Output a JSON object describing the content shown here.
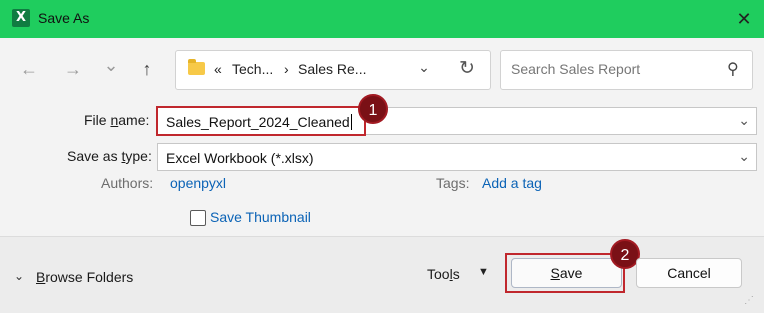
{
  "window": {
    "title": "Save As",
    "app_icon_letter": "X",
    "close_glyph": "✕"
  },
  "nav": {
    "back_glyph": "←",
    "forward_glyph": "→",
    "recent_glyph": "⌄",
    "up_glyph": "↑",
    "breadcrumb_overflow": "«",
    "crumb_1": "Tech...",
    "crumb_sep": "›",
    "crumb_2": "Sales Re...",
    "address_chevron": "⌄",
    "refresh_glyph": "↻"
  },
  "search": {
    "placeholder": "Search Sales Report",
    "icon_glyph": "⚲"
  },
  "form": {
    "file_name_label_pre": "File ",
    "file_name_label_u": "n",
    "file_name_label_post": "ame:",
    "file_name_value": "Sales_Report_2024_Cleaned",
    "save_as_type_label_pre": "Save as ",
    "save_as_type_label_u": "t",
    "save_as_type_label_post": "ype:",
    "save_as_type_value": "Excel Workbook (*.xlsx)",
    "authors_label": "Authors:",
    "authors_value": "openpyxl",
    "tags_label": "Tags:",
    "tags_value": "Add a tag",
    "save_thumbnail_label": "Save Thumbnail",
    "save_thumbnail_checked": false,
    "combo_chevron": "⌄"
  },
  "footer": {
    "browse_chevron": "⌄",
    "browse_label_u": "B",
    "browse_label_rest": "rowse Folders",
    "tools_label_pre": "Too",
    "tools_label_u": "l",
    "tools_label_post": "s",
    "tools_arrow": "▼",
    "save_label_u": "S",
    "save_label_rest": "ave",
    "cancel_label": "Cancel"
  },
  "annotations": {
    "badge_1": "1",
    "badge_2": "2",
    "highlight_color": "#c0272d",
    "badge_color": "#7a1016"
  }
}
